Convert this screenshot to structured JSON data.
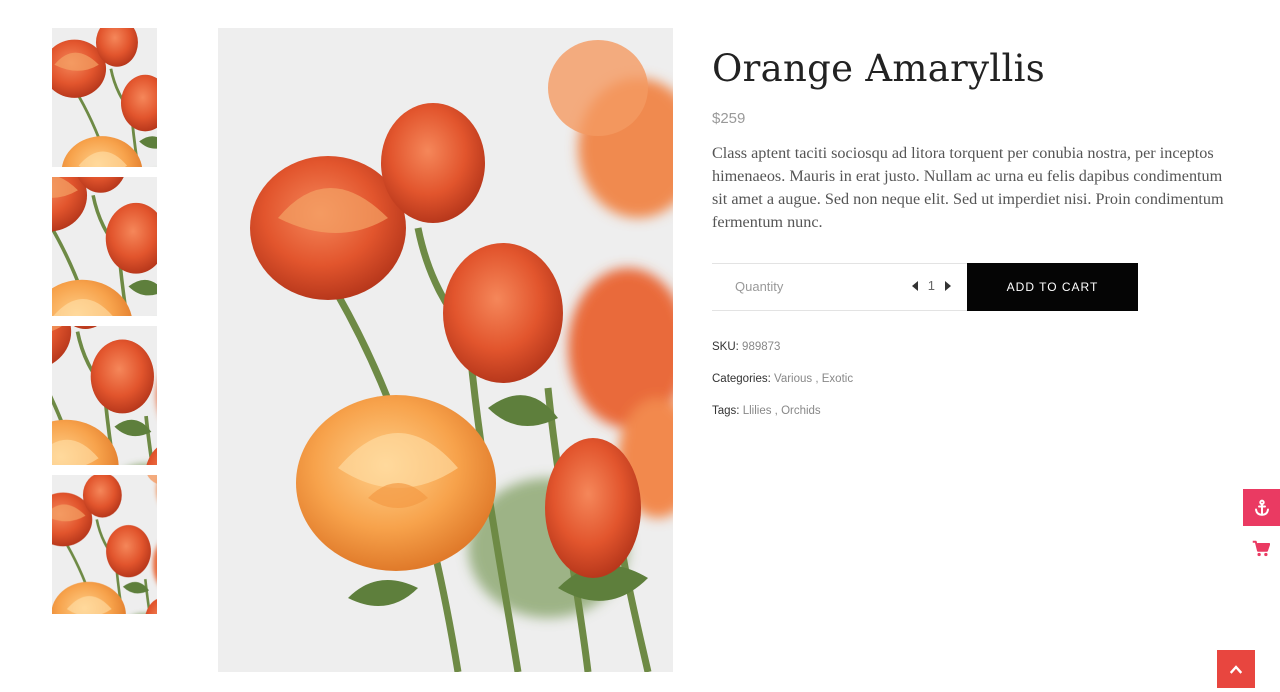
{
  "product": {
    "title": "Orange Amaryllis",
    "price": "$259",
    "description": "Class aptent taciti sociosqu ad litora torquent per conubia nostra, per inceptos himenaeos. Mauris in erat justo. Nullam ac urna eu felis dapibus condimentum sit amet a augue. Sed non neque elit. Sed ut imperdiet nisi. Proin condimentum fermentum nunc."
  },
  "cart": {
    "quantity_label": "Quantity",
    "quantity_value": "1",
    "add_button": "ADD TO CART"
  },
  "meta": {
    "sku_label": "SKU:",
    "sku_value": "989873",
    "categories_label": "Categories:",
    "categories": [
      "Various",
      "Exotic"
    ],
    "tags_label": "Tags:",
    "tags": [
      "Llilies",
      "Orchids"
    ]
  },
  "colors": {
    "accent": "#ea3a62",
    "to_top": "#e8463f",
    "button": "#050505"
  },
  "icons": {
    "side_anchor": "anchor-icon",
    "side_cart": "cart-icon",
    "to_top": "chevron-up-icon"
  }
}
